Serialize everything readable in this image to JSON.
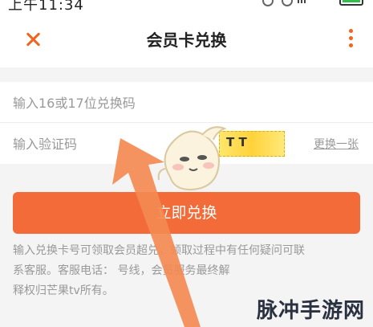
{
  "status_bar": {
    "time": "上午11:34"
  },
  "header": {
    "title": "会员卡兑换"
  },
  "form": {
    "code_placeholder": "输入16或17位兑换码",
    "verify_placeholder": "输入验证码",
    "captcha_text": "T   T",
    "refresh_label": "更换一张"
  },
  "submit_label": "立即兑换",
  "notice": {
    "line1": "输入兑换卡号可领取会员超兑，领取过程中有任何疑问可联",
    "line2": "系客服。客服电话：          号线，会员服务最终解",
    "line3": "释权归芒果tv所有。"
  },
  "watermark": {
    "text": "脉冲手游网"
  },
  "colors": {
    "accent": "#f26b39",
    "icon_accent": "#f0641e"
  }
}
